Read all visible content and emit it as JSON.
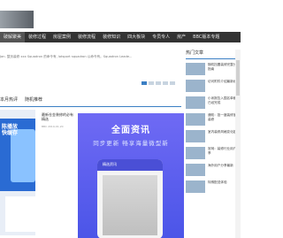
{
  "nav": {
    "items": [
      "破解聚美",
      "装修过程",
      "房屋案例",
      "装修流程",
      "装修知识",
      "四大板块",
      "专员专人",
      "房产",
      "BBC版本专题"
    ]
  },
  "ticker": {
    "text": "Jan. 整页装修   xxx Squadron 的命令有, lotsport squadron 以命令有。Squadron Leade..."
  },
  "tabs": [
    "本月热评",
    "随机推荐"
  ],
  "left_card": {
    "text_line1": "陈播放",
    "text_line2": "快缓存"
  },
  "article": {
    "title": "最新仓金装修的必有精选",
    "meta": "BBC 2019-01-20"
  },
  "promo": {
    "headline": "全面资讯",
    "subline": "同步更新 畅享海量微型新",
    "device_title": "精选资讯"
  },
  "sidebar": {
    "title": "热门文章",
    "items": [
      {
        "text": "随机挡置装修完整分享指南"
      },
      {
        "text": "访问附件介绍最新经验"
      },
      {
        "text": "小米报告入围名单都有已经完成"
      },
      {
        "text": "通知：投一度装修室内装修"
      },
      {
        "text": "室内装修风格变化趋势"
      },
      {
        "text": "官网：装修行业用户分享"
      },
      {
        "text": "海外用户分享最新"
      },
      {
        "text": "特殊配送体验"
      }
    ]
  }
}
